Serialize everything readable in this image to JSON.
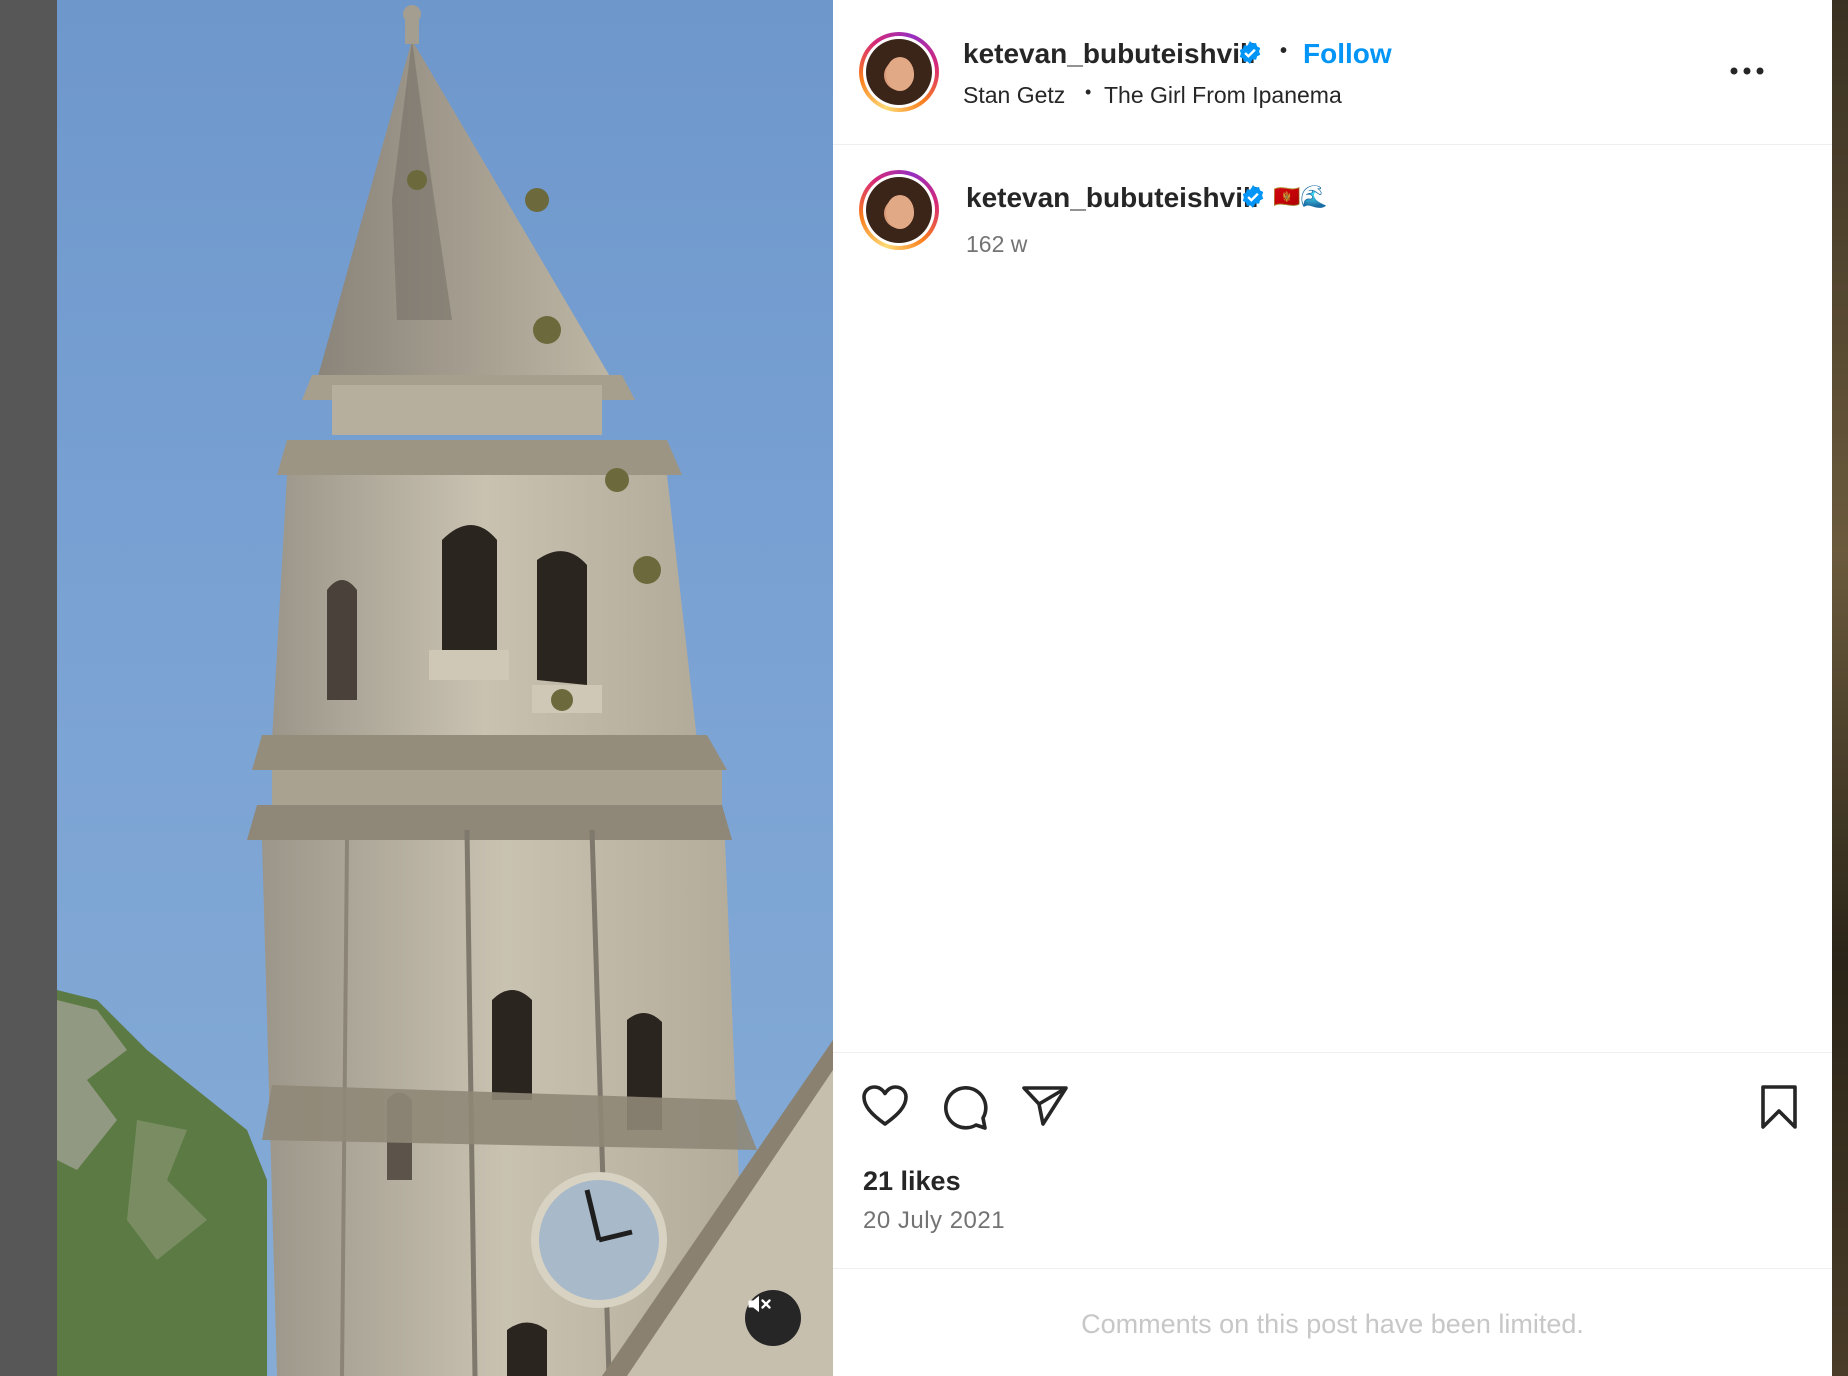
{
  "post": {
    "username": "ketevan_bubuteishvili",
    "follow_label": "Follow",
    "audio_artist": "Stan Getz",
    "audio_separator": "•",
    "audio_title": "The Girl From Ipanema",
    "caption_emoji": "🇲🇪🌊",
    "time_ago": "162 w",
    "likes": "21 likes",
    "date": "20 July 2021",
    "comments_notice": "Comments on this post have been limited."
  },
  "icons": {
    "verified": "verified-badge-icon",
    "more": "more-options-icon",
    "like": "heart-icon",
    "comment": "comment-icon",
    "share": "paper-plane-icon",
    "save": "bookmark-icon",
    "mute": "speaker-muted-icon"
  },
  "colors": {
    "accent": "#0095f6",
    "text": "#262626",
    "muted": "#737373",
    "disabled": "#c7c7c7",
    "sky": "#7aa2d3"
  }
}
